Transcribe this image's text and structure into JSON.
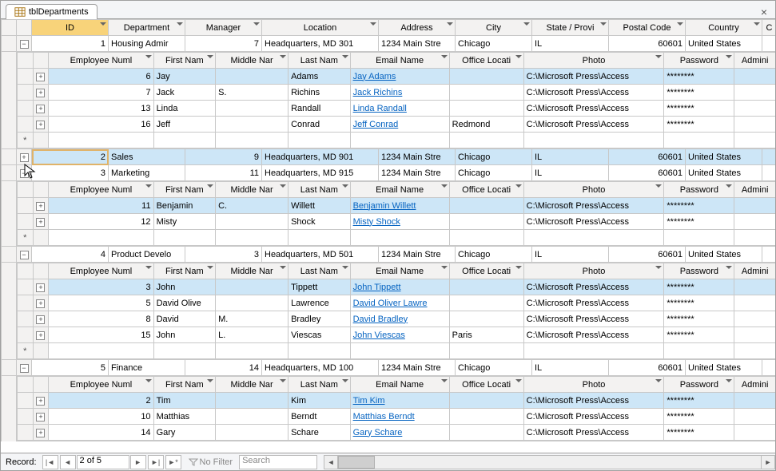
{
  "tab": {
    "title": "tblDepartments"
  },
  "dept_cols": [
    "ID",
    "Department",
    "Manager",
    "Location",
    "Address",
    "City",
    "State / Provi",
    "Postal Code",
    "Country",
    "C"
  ],
  "emp_cols": [
    "Employee Numl",
    "First Nam",
    "Middle Nar",
    "Last Nam",
    "Email Name",
    "Office Locati",
    "Photo",
    "Password",
    "Admini"
  ],
  "depts": [
    {
      "id": "1",
      "dept": "Housing Admir",
      "mgr": "7",
      "loc": "Headquarters, MD 301",
      "addr": "1234 Main Stre",
      "city": "Chicago",
      "state": "IL",
      "post": "60601",
      "cty": "United States",
      "emps": [
        {
          "num": "6",
          "fn": "Jay",
          "mn": "",
          "ln": "Adams",
          "em": "Jay Adams",
          "ol": "",
          "ph": "C:\\Microsoft Press\\Access",
          "pw": "********"
        },
        {
          "num": "7",
          "fn": "Jack",
          "mn": "S.",
          "ln": "Richins",
          "em": "Jack Richins",
          "ol": "",
          "ph": "C:\\Microsoft Press\\Access",
          "pw": "********"
        },
        {
          "num": "13",
          "fn": "Linda",
          "mn": "",
          "ln": "Randall",
          "em": "Linda Randall",
          "ol": "",
          "ph": "C:\\Microsoft Press\\Access",
          "pw": "********"
        },
        {
          "num": "16",
          "fn": "Jeff",
          "mn": "",
          "ln": "Conrad",
          "em": "Jeff Conrad",
          "ol": "Redmond",
          "ph": "C:\\Microsoft Press\\Access",
          "pw": "********"
        }
      ]
    },
    {
      "id": "2",
      "dept": "Sales",
      "mgr": "9",
      "loc": "Headquarters, MD 901",
      "addr": "1234 Main Stre",
      "city": "Chicago",
      "state": "IL",
      "post": "60601",
      "cty": "United States",
      "emps": []
    },
    {
      "id": "3",
      "dept": "Marketing",
      "mgr": "11",
      "loc": "Headquarters, MD 915",
      "addr": "1234 Main Stre",
      "city": "Chicago",
      "state": "IL",
      "post": "60601",
      "cty": "United States",
      "emps": [
        {
          "num": "11",
          "fn": "Benjamin",
          "mn": "C.",
          "ln": "Willett",
          "em": "Benjamin Willett",
          "ol": "",
          "ph": "C:\\Microsoft Press\\Access",
          "pw": "********"
        },
        {
          "num": "12",
          "fn": "Misty",
          "mn": "",
          "ln": "Shock",
          "em": "Misty Shock",
          "ol": "",
          "ph": "C:\\Microsoft Press\\Access",
          "pw": "********"
        }
      ]
    },
    {
      "id": "4",
      "dept": "Product Develo",
      "mgr": "3",
      "loc": "Headquarters, MD 501",
      "addr": "1234 Main Stre",
      "city": "Chicago",
      "state": "IL",
      "post": "60601",
      "cty": "United States",
      "emps": [
        {
          "num": "3",
          "fn": "John",
          "mn": "",
          "ln": "Tippett",
          "em": "John Tippett",
          "ol": "",
          "ph": "C:\\Microsoft Press\\Access",
          "pw": "********"
        },
        {
          "num": "5",
          "fn": "David Olive",
          "mn": "",
          "ln": "Lawrence",
          "em": "David Oliver Lawre",
          "ol": "",
          "ph": "C:\\Microsoft Press\\Access",
          "pw": "********"
        },
        {
          "num": "8",
          "fn": "David",
          "mn": "M.",
          "ln": "Bradley",
          "em": "David Bradley",
          "ol": "",
          "ph": "C:\\Microsoft Press\\Access",
          "pw": "********"
        },
        {
          "num": "15",
          "fn": "John",
          "mn": "L.",
          "ln": "Viescas",
          "em": "John Viescas",
          "ol": "Paris",
          "ph": "C:\\Microsoft Press\\Access",
          "pw": "********"
        }
      ]
    },
    {
      "id": "5",
      "dept": "Finance",
      "mgr": "14",
      "loc": "Headquarters, MD 100",
      "addr": "1234 Main Stre",
      "city": "Chicago",
      "state": "IL",
      "post": "60601",
      "cty": "United States",
      "emps": [
        {
          "num": "2",
          "fn": "Tim",
          "mn": "",
          "ln": "Kim",
          "em": "Tim Kim",
          "ol": "",
          "ph": "C:\\Microsoft Press\\Access",
          "pw": "********"
        },
        {
          "num": "10",
          "fn": "Matthias",
          "mn": "",
          "ln": "Berndt",
          "em": "Matthias Berndt",
          "ol": "",
          "ph": "C:\\Microsoft Press\\Access",
          "pw": "********"
        },
        {
          "num": "14",
          "fn": "Gary",
          "mn": "",
          "ln": "Schare",
          "em": "Gary Schare",
          "ol": "",
          "ph": "C:\\Microsoft Press\\Access",
          "pw": "********"
        }
      ]
    }
  ],
  "nav": {
    "record_label": "Record:",
    "position": "2 of 5",
    "filter": "No Filter",
    "search": "Search"
  }
}
